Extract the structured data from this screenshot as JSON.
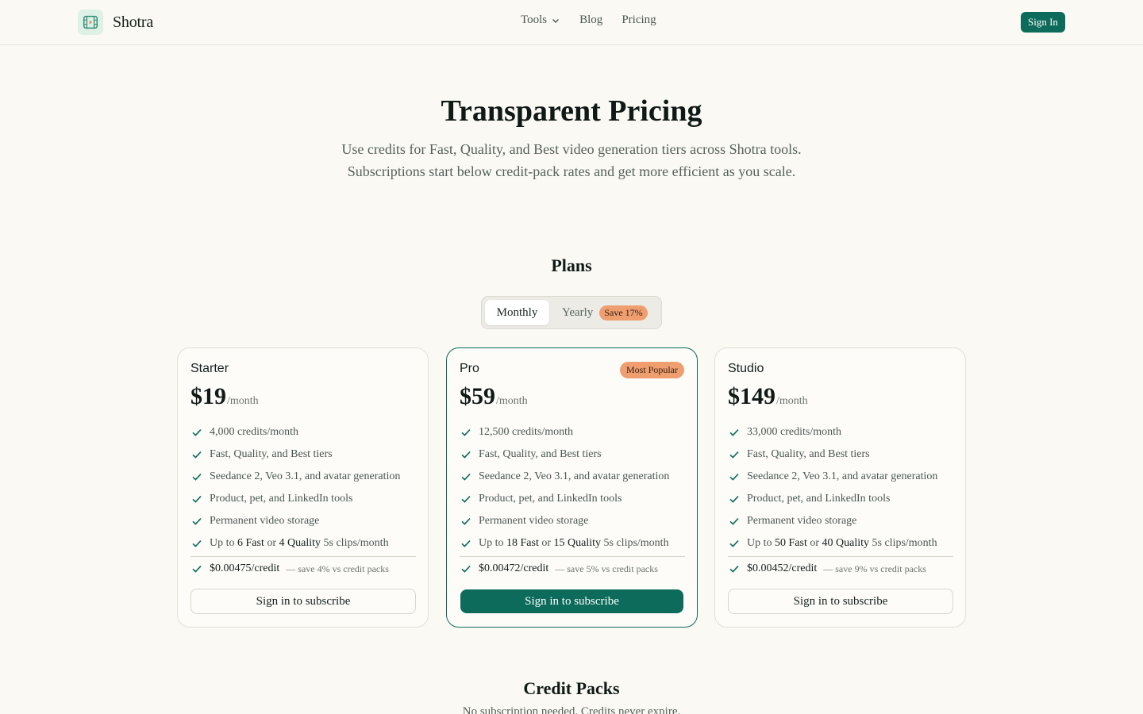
{
  "nav": {
    "brand": "Shotra",
    "logo_icon": "film-play-icon",
    "links": [
      {
        "label": "Tools",
        "has_dropdown": true
      },
      {
        "label": "Blog"
      },
      {
        "label": "Pricing"
      }
    ],
    "signin_label": "Sign In"
  },
  "hero": {
    "title": "Transparent Pricing",
    "subtitle": "Use credits for Fast, Quality, and Best video generation tiers across Shotra tools. Subscriptions start below credit-pack rates and get more efficient as you scale."
  },
  "plans": {
    "title": "Plans",
    "toggle": {
      "monthly": "Monthly",
      "yearly": "Yearly",
      "yearly_badge": "Save 17%",
      "selected": "Monthly"
    },
    "cards": [
      {
        "name": "Starter",
        "price": "$19",
        "per": "/month",
        "features": [
          "4,000 credits/month",
          "Fast, Quality, and Best tiers",
          "Seedance 2, Veo 3.1, and avatar generation",
          "Product, pet, and LinkedIn tools",
          "Permanent video storage"
        ],
        "clips": {
          "prefix": "Up to",
          "fast": "6 Fast",
          "or": "or",
          "quality": "4 Quality",
          "suffix": "5s clips/month"
        },
        "rate": "$0.00475/credit",
        "rate_note": "— save 4% vs credit packs",
        "button": "Sign in to subscribe"
      },
      {
        "name": "Pro",
        "badge": "Most Popular",
        "price": "$59",
        "per": "/month",
        "features": [
          "12,500 credits/month",
          "Fast, Quality, and Best tiers",
          "Seedance 2, Veo 3.1, and avatar generation",
          "Product, pet, and LinkedIn tools",
          "Permanent video storage"
        ],
        "clips": {
          "prefix": "Up to",
          "fast": "18 Fast",
          "or": "or",
          "quality": "15 Quality",
          "suffix": "5s clips/month"
        },
        "rate": "$0.00472/credit",
        "rate_note": "— save 5% vs credit packs",
        "button": "Sign in to subscribe"
      },
      {
        "name": "Studio",
        "price": "$149",
        "per": "/month",
        "features": [
          "33,000 credits/month",
          "Fast, Quality, and Best tiers",
          "Seedance 2, Veo 3.1, and avatar generation",
          "Product, pet, and LinkedIn tools",
          "Permanent video storage"
        ],
        "clips": {
          "prefix": "Up to",
          "fast": "50 Fast",
          "or": "or",
          "quality": "40 Quality",
          "suffix": "5s clips/month"
        },
        "rate": "$0.00452/credit",
        "rate_note": "— save 9% vs credit packs",
        "button": "Sign in to subscribe"
      }
    ]
  },
  "packs": {
    "title": "Credit Packs",
    "subtitle": "No subscription needed. Credits never expire."
  },
  "colors": {
    "accent": "#0c6b5a",
    "badge": "#ee9e6f",
    "background": "#fbf9f4"
  }
}
